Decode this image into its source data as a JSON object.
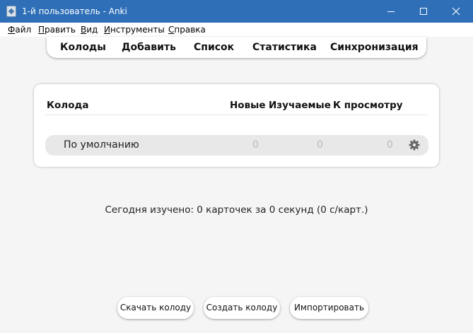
{
  "window": {
    "title": "1-й пользователь - Anki",
    "controls": {
      "minimize": "minimize-icon",
      "maximize": "maximize-icon",
      "close": "close-icon"
    },
    "titlebar_color": "#2f6fb8"
  },
  "menu": {
    "items": [
      {
        "label": "Файл",
        "access_key": "Ф",
        "rest": "айл"
      },
      {
        "label": "Править",
        "access_key": "П",
        "rest": "равить"
      },
      {
        "label": "Вид",
        "access_key": "В",
        "rest": "ид"
      },
      {
        "label": "Инструменты",
        "access_key": "И",
        "rest": "нструменты"
      },
      {
        "label": "Справка",
        "access_key": "С",
        "rest": "правка"
      }
    ]
  },
  "toolbar": {
    "items": [
      "Колоды",
      "Добавить",
      "Список",
      "Статистика",
      "Синхронизация"
    ]
  },
  "deck_table": {
    "headers": {
      "deck": "Колода",
      "new": "Новые",
      "learning": "Изучаемые",
      "review": "К просмотру"
    },
    "rows": [
      {
        "name": "По умолчанию",
        "new": "0",
        "learning": "0",
        "review": "0",
        "options_icon": "gear-icon"
      }
    ],
    "count_color": "#b8b8b8"
  },
  "stats": {
    "text": "Сегодня изучено: 0 карточек за 0 секунд (0 с/карт.)"
  },
  "bottom_buttons": {
    "download": "Скачать колоду",
    "create": "Создать колоду",
    "import": "Импортировать"
  }
}
